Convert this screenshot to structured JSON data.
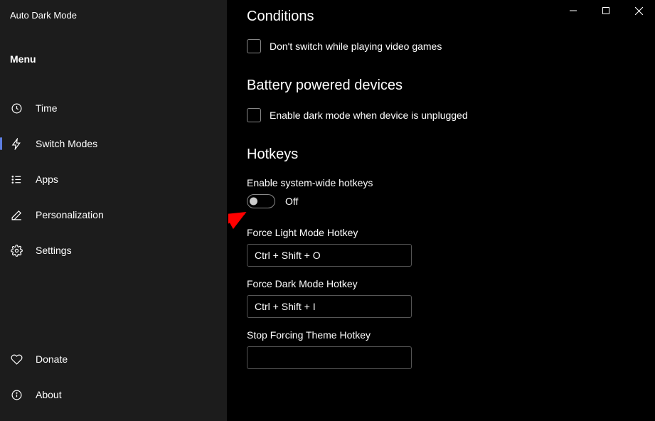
{
  "app": {
    "title": "Auto Dark Mode"
  },
  "menu": {
    "heading": "Menu"
  },
  "nav": {
    "items": [
      {
        "id": "time",
        "label": "Time",
        "icon": "clock-icon",
        "active": false
      },
      {
        "id": "switch-modes",
        "label": "Switch Modes",
        "icon": "bolt-icon",
        "active": true
      },
      {
        "id": "apps",
        "label": "Apps",
        "icon": "list-icon",
        "active": false
      },
      {
        "id": "personalization",
        "label": "Personalization",
        "icon": "pencil-icon",
        "active": false
      },
      {
        "id": "settings",
        "label": "Settings",
        "icon": "gear-icon",
        "active": false
      }
    ],
    "bottom": [
      {
        "id": "donate",
        "label": "Donate",
        "icon": "heart-icon"
      },
      {
        "id": "about",
        "label": "About",
        "icon": "info-icon"
      }
    ]
  },
  "sections": {
    "conditions": {
      "title": "Conditions",
      "checkbox1": "Don't switch while playing video games"
    },
    "battery": {
      "title": "Battery powered devices",
      "checkbox1": "Enable dark mode when device is unplugged"
    },
    "hotkeys": {
      "title": "Hotkeys",
      "enable_label": "Enable system-wide hotkeys",
      "toggle_state": "Off",
      "force_light_label": "Force Light Mode Hotkey",
      "force_light_value": "Ctrl + Shift + O",
      "force_dark_label": "Force Dark Mode Hotkey",
      "force_dark_value": "Ctrl + Shift + I",
      "stop_forcing_label": "Stop Forcing Theme Hotkey",
      "stop_forcing_value": ""
    }
  }
}
